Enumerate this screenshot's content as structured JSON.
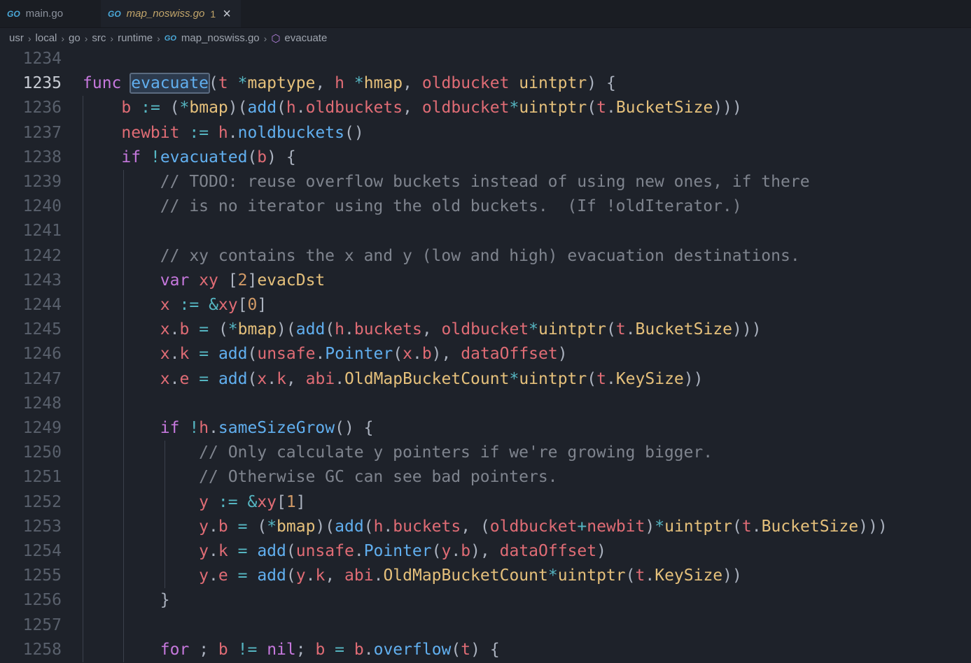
{
  "tabs": [
    {
      "icon": "go-icon",
      "label": "main.go",
      "active": false
    },
    {
      "icon": "go-icon",
      "label": "map_noswiss.go",
      "badge": "1",
      "active": true
    }
  ],
  "breadcrumb": {
    "items": [
      "usr",
      "local",
      "go",
      "src",
      "runtime",
      "map_noswiss.go",
      "evacuate"
    ]
  },
  "editor": {
    "current_line": "1235",
    "lines": [
      {
        "num": "1234",
        "text": ""
      },
      {
        "num": "1235",
        "text": "func evacuate(t *maptype, h *hmap, oldbucket uintptr) {"
      },
      {
        "num": "1236",
        "text": "    b := (*bmap)(add(h.oldbuckets, oldbucket*uintptr(t.BucketSize)))"
      },
      {
        "num": "1237",
        "text": "    newbit := h.noldbuckets()"
      },
      {
        "num": "1238",
        "text": "    if !evacuated(b) {"
      },
      {
        "num": "1239",
        "text": "        // TODO: reuse overflow buckets instead of using new ones, if there"
      },
      {
        "num": "1240",
        "text": "        // is no iterator using the old buckets.  (If !oldIterator.)"
      },
      {
        "num": "1241",
        "text": ""
      },
      {
        "num": "1242",
        "text": "        // xy contains the x and y (low and high) evacuation destinations."
      },
      {
        "num": "1243",
        "text": "        var xy [2]evacDst"
      },
      {
        "num": "1244",
        "text": "        x := &xy[0]"
      },
      {
        "num": "1245",
        "text": "        x.b = (*bmap)(add(h.buckets, oldbucket*uintptr(t.BucketSize)))"
      },
      {
        "num": "1246",
        "text": "        x.k = add(unsafe.Pointer(x.b), dataOffset)"
      },
      {
        "num": "1247",
        "text": "        x.e = add(x.k, abi.OldMapBucketCount*uintptr(t.KeySize))"
      },
      {
        "num": "1248",
        "text": ""
      },
      {
        "num": "1249",
        "text": "        if !h.sameSizeGrow() {"
      },
      {
        "num": "1250",
        "text": "            // Only calculate y pointers if we're growing bigger."
      },
      {
        "num": "1251",
        "text": "            // Otherwise GC can see bad pointers."
      },
      {
        "num": "1252",
        "text": "            y := &xy[1]"
      },
      {
        "num": "1253",
        "text": "            y.b = (*bmap)(add(h.buckets, (oldbucket+newbit)*uintptr(t.BucketSize)))"
      },
      {
        "num": "1254",
        "text": "            y.k = add(unsafe.Pointer(y.b), dataOffset)"
      },
      {
        "num": "1255",
        "text": "            y.e = add(y.k, abi.OldMapBucketCount*uintptr(t.KeySize))"
      },
      {
        "num": "1256",
        "text": "        }"
      },
      {
        "num": "1257",
        "text": ""
      },
      {
        "num": "1258",
        "text": "        for ; b != nil; b = b.overflow(t) {"
      }
    ]
  },
  "colors": {
    "background": "#1e222a",
    "keyword": "#c678dd",
    "function": "#61afef",
    "variable": "#e06c75",
    "type": "#e5c07b",
    "comment": "#7f848e",
    "number": "#d19a66",
    "operator": "#56b6c2"
  }
}
